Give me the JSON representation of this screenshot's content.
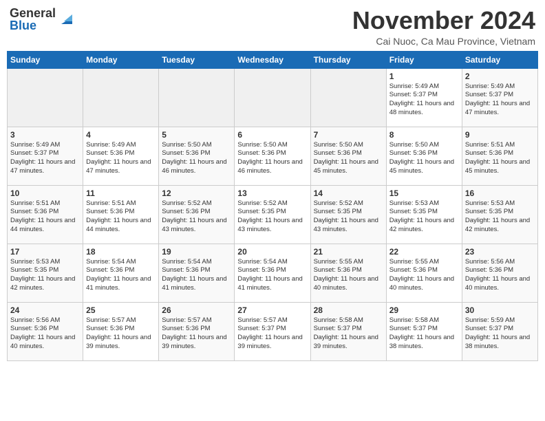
{
  "logo": {
    "line1": "General",
    "line2": "Blue"
  },
  "title": "November 2024",
  "location": "Cai Nuoc, Ca Mau Province, Vietnam",
  "weekdays": [
    "Sunday",
    "Monday",
    "Tuesday",
    "Wednesday",
    "Thursday",
    "Friday",
    "Saturday"
  ],
  "weeks": [
    [
      {
        "day": "",
        "info": ""
      },
      {
        "day": "",
        "info": ""
      },
      {
        "day": "",
        "info": ""
      },
      {
        "day": "",
        "info": ""
      },
      {
        "day": "",
        "info": ""
      },
      {
        "day": "1",
        "info": "Sunrise: 5:49 AM\nSunset: 5:37 PM\nDaylight: 11 hours and 48 minutes."
      },
      {
        "day": "2",
        "info": "Sunrise: 5:49 AM\nSunset: 5:37 PM\nDaylight: 11 hours and 47 minutes."
      }
    ],
    [
      {
        "day": "3",
        "info": "Sunrise: 5:49 AM\nSunset: 5:37 PM\nDaylight: 11 hours and 47 minutes."
      },
      {
        "day": "4",
        "info": "Sunrise: 5:49 AM\nSunset: 5:36 PM\nDaylight: 11 hours and 47 minutes."
      },
      {
        "day": "5",
        "info": "Sunrise: 5:50 AM\nSunset: 5:36 PM\nDaylight: 11 hours and 46 minutes."
      },
      {
        "day": "6",
        "info": "Sunrise: 5:50 AM\nSunset: 5:36 PM\nDaylight: 11 hours and 46 minutes."
      },
      {
        "day": "7",
        "info": "Sunrise: 5:50 AM\nSunset: 5:36 PM\nDaylight: 11 hours and 45 minutes."
      },
      {
        "day": "8",
        "info": "Sunrise: 5:50 AM\nSunset: 5:36 PM\nDaylight: 11 hours and 45 minutes."
      },
      {
        "day": "9",
        "info": "Sunrise: 5:51 AM\nSunset: 5:36 PM\nDaylight: 11 hours and 45 minutes."
      }
    ],
    [
      {
        "day": "10",
        "info": "Sunrise: 5:51 AM\nSunset: 5:36 PM\nDaylight: 11 hours and 44 minutes."
      },
      {
        "day": "11",
        "info": "Sunrise: 5:51 AM\nSunset: 5:36 PM\nDaylight: 11 hours and 44 minutes."
      },
      {
        "day": "12",
        "info": "Sunrise: 5:52 AM\nSunset: 5:36 PM\nDaylight: 11 hours and 43 minutes."
      },
      {
        "day": "13",
        "info": "Sunrise: 5:52 AM\nSunset: 5:35 PM\nDaylight: 11 hours and 43 minutes."
      },
      {
        "day": "14",
        "info": "Sunrise: 5:52 AM\nSunset: 5:35 PM\nDaylight: 11 hours and 43 minutes."
      },
      {
        "day": "15",
        "info": "Sunrise: 5:53 AM\nSunset: 5:35 PM\nDaylight: 11 hours and 42 minutes."
      },
      {
        "day": "16",
        "info": "Sunrise: 5:53 AM\nSunset: 5:35 PM\nDaylight: 11 hours and 42 minutes."
      }
    ],
    [
      {
        "day": "17",
        "info": "Sunrise: 5:53 AM\nSunset: 5:35 PM\nDaylight: 11 hours and 42 minutes."
      },
      {
        "day": "18",
        "info": "Sunrise: 5:54 AM\nSunset: 5:36 PM\nDaylight: 11 hours and 41 minutes."
      },
      {
        "day": "19",
        "info": "Sunrise: 5:54 AM\nSunset: 5:36 PM\nDaylight: 11 hours and 41 minutes."
      },
      {
        "day": "20",
        "info": "Sunrise: 5:54 AM\nSunset: 5:36 PM\nDaylight: 11 hours and 41 minutes."
      },
      {
        "day": "21",
        "info": "Sunrise: 5:55 AM\nSunset: 5:36 PM\nDaylight: 11 hours and 40 minutes."
      },
      {
        "day": "22",
        "info": "Sunrise: 5:55 AM\nSunset: 5:36 PM\nDaylight: 11 hours and 40 minutes."
      },
      {
        "day": "23",
        "info": "Sunrise: 5:56 AM\nSunset: 5:36 PM\nDaylight: 11 hours and 40 minutes."
      }
    ],
    [
      {
        "day": "24",
        "info": "Sunrise: 5:56 AM\nSunset: 5:36 PM\nDaylight: 11 hours and 40 minutes."
      },
      {
        "day": "25",
        "info": "Sunrise: 5:57 AM\nSunset: 5:36 PM\nDaylight: 11 hours and 39 minutes."
      },
      {
        "day": "26",
        "info": "Sunrise: 5:57 AM\nSunset: 5:36 PM\nDaylight: 11 hours and 39 minutes."
      },
      {
        "day": "27",
        "info": "Sunrise: 5:57 AM\nSunset: 5:37 PM\nDaylight: 11 hours and 39 minutes."
      },
      {
        "day": "28",
        "info": "Sunrise: 5:58 AM\nSunset: 5:37 PM\nDaylight: 11 hours and 39 minutes."
      },
      {
        "day": "29",
        "info": "Sunrise: 5:58 AM\nSunset: 5:37 PM\nDaylight: 11 hours and 38 minutes."
      },
      {
        "day": "30",
        "info": "Sunrise: 5:59 AM\nSunset: 5:37 PM\nDaylight: 11 hours and 38 minutes."
      }
    ]
  ]
}
